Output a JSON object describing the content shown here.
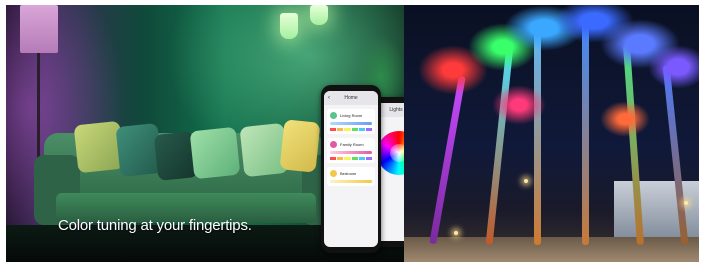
{
  "banner": {
    "tagline": "Color tuning at your fingertips."
  },
  "phone_front": {
    "header": "Home",
    "cards": [
      {
        "name": "Living Room",
        "color": "#59c38d"
      },
      {
        "name": "Family Room",
        "color": "#e05aa0"
      },
      {
        "name": "Bedroom",
        "color": "#f2c84b"
      }
    ]
  },
  "phone_back": {
    "header": "Lights"
  },
  "colors": {
    "accent_green": "#12704c",
    "night_sky": "#0a1022"
  }
}
